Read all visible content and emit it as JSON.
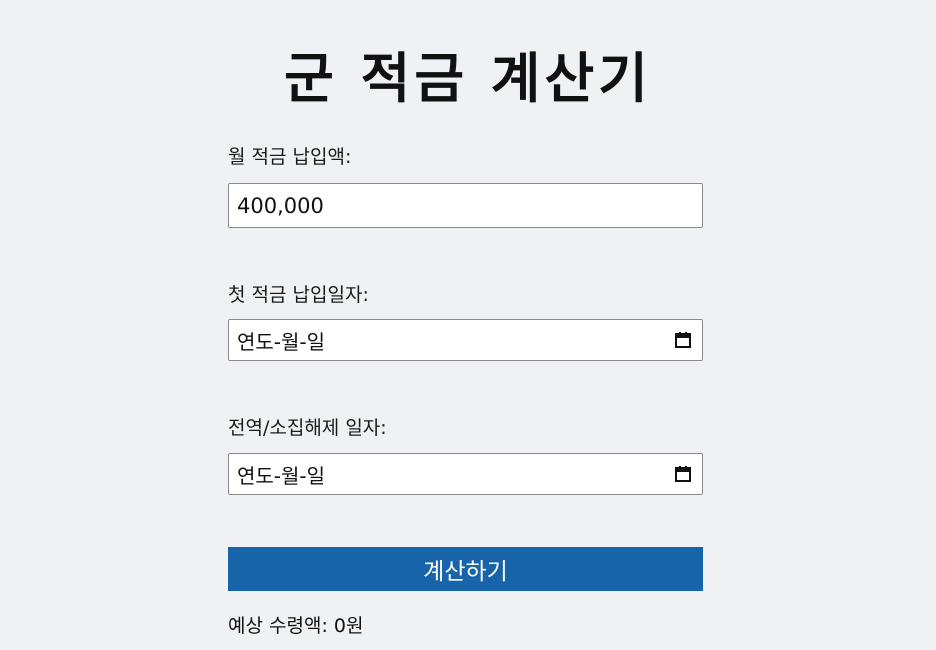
{
  "title": "군 적금 계산기",
  "monthly_deposit": {
    "label": "월 적금 납입액:",
    "value": "400,000"
  },
  "first_deposit_date": {
    "label": "첫 적금 납입일자:",
    "placeholder": "연도-월-일"
  },
  "discharge_date": {
    "label": "전역/소집해제 일자:",
    "placeholder": "연도-월-일"
  },
  "calculate_button": "계산하기",
  "result": {
    "label": "예상 수령액:",
    "value": "0원"
  },
  "colors": {
    "background": "#f0f1f4",
    "button": "#1764aa",
    "button_text": "#ffffff"
  },
  "icons": {
    "date_picker": "calendar-icon"
  }
}
